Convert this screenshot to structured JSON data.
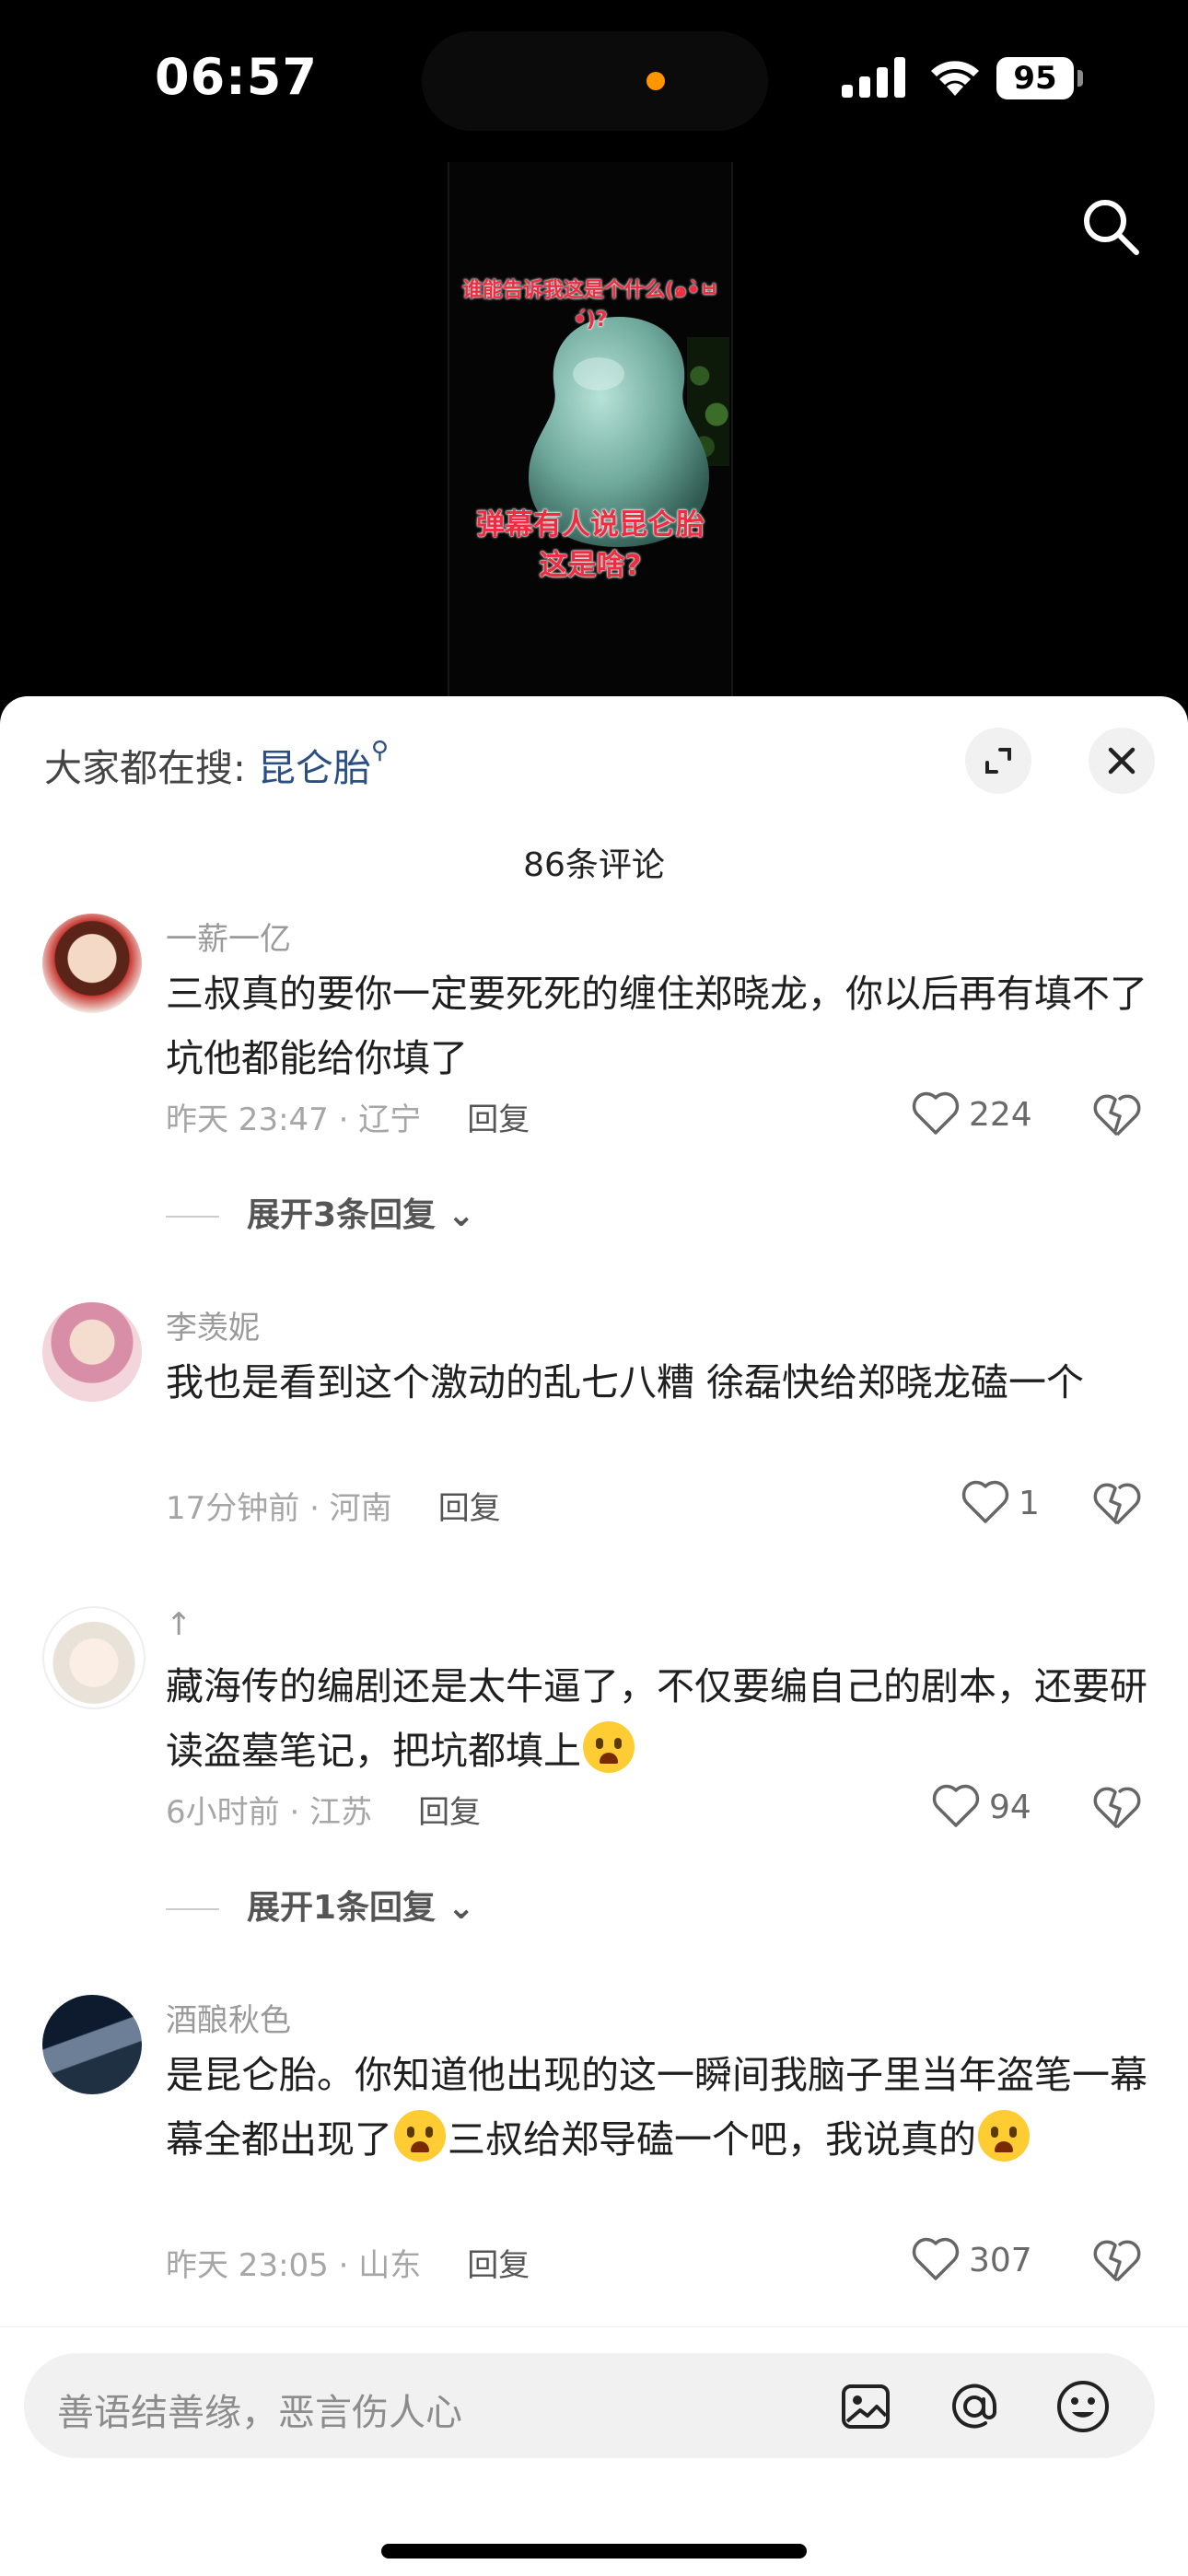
{
  "status_bar": {
    "time": "06:57",
    "battery": "95"
  },
  "video": {
    "caption_top": "谁能告诉我这是个什么(๑•̀ㅂ•́)?",
    "caption_bottom": "弹幕有人说昆仑胎这是啥?"
  },
  "sheet": {
    "trending_prefix": "大家都在搜: ",
    "trending_keyword": "昆仑胎",
    "comment_count": "86条评论"
  },
  "comments": [
    {
      "username": "一薪一亿",
      "text": "三叔真的要你一定要死死的缠住郑晓龙，你以后再有填不了坑他都能给你填了",
      "meta": "昨天 23:47 · 辽宁",
      "reply_label": "回复",
      "likes": "224",
      "expand_label": "展开3条回复"
    },
    {
      "username": "李羡妮",
      "text": "我也是看到这个激动的乱七八糟 徐磊快给郑晓龙磕一个",
      "meta": "17分钟前 · 河南",
      "reply_label": "回复",
      "likes": "1"
    },
    {
      "username": "↑",
      "text": "藏海传的编剧还是太牛逼了，不仅要编自己的剧本，还要研读盗墓笔记，把坑都填上",
      "meta": "6小时前 · 江苏",
      "reply_label": "回复",
      "likes": "94",
      "expand_label": "展开1条回复"
    },
    {
      "username": "酒酿秋色",
      "text_part1": "是昆仑胎。你知道他出现的这一瞬间我脑子里当年盗笔一幕幕全都出现了",
      "text_part2": "三叔给郑导磕一个吧，我说真的",
      "meta": "昨天 23:05 · 山东",
      "reply_label": "回复",
      "likes": "307"
    }
  ],
  "input": {
    "placeholder": "善语结善缘，恶言伤人心"
  },
  "colors": {
    "accent_link": "#2c4f82",
    "caption_red": "#f02c40",
    "status_orange": "#ff9500"
  }
}
